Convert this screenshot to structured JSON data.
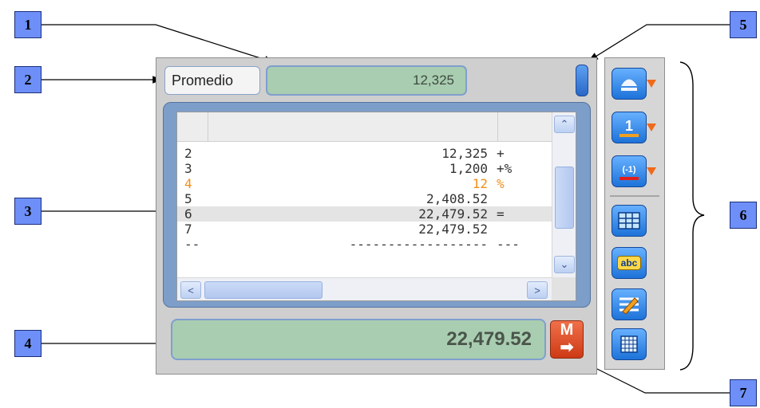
{
  "callouts": [
    "1",
    "2",
    "3",
    "4",
    "5",
    "6",
    "7"
  ],
  "widget": {
    "function_button_label": "Promedio",
    "top_display_value": "12,325",
    "bottom_display_value": "22,479.52",
    "memory_button_label": "M",
    "memory_button_arrow": "➡"
  },
  "tape": {
    "rows": [
      {
        "n": "2",
        "value": "12,325",
        "op": "+"
      },
      {
        "n": "3",
        "value": "1,200",
        "op": "+%"
      },
      {
        "n": "4",
        "value": "12",
        "op": "%"
      },
      {
        "n": "5",
        "value": "2,408.52",
        "op": ""
      },
      {
        "n": "6",
        "value": "22,479.52",
        "op": "="
      },
      {
        "n": "7",
        "value": "22,479.52",
        "op": ""
      },
      {
        "n": "--",
        "value": "------------------",
        "op": "---"
      }
    ],
    "scroll_up_glyph": "⌃",
    "scroll_down_glyph": "⌄",
    "scroll_left_glyph": "<",
    "scroll_right_glyph": ">"
  },
  "toolbar": {
    "button_badges": [
      "1",
      "(-1)",
      "abc"
    ]
  },
  "colors": {
    "callout_fill": "#6d8ff7",
    "display_green": "#a9cdb0",
    "highlight_orange": "#f0901a",
    "memory_red": "#cd3a14",
    "toolbar_blue": "#1d73d9"
  },
  "icons": [
    "eject-icon",
    "number-one-icon",
    "negative-one-icon",
    "table-icon",
    "spell-check-icon",
    "edit-list-icon",
    "grid-icon",
    "memory-transfer-icon"
  ]
}
